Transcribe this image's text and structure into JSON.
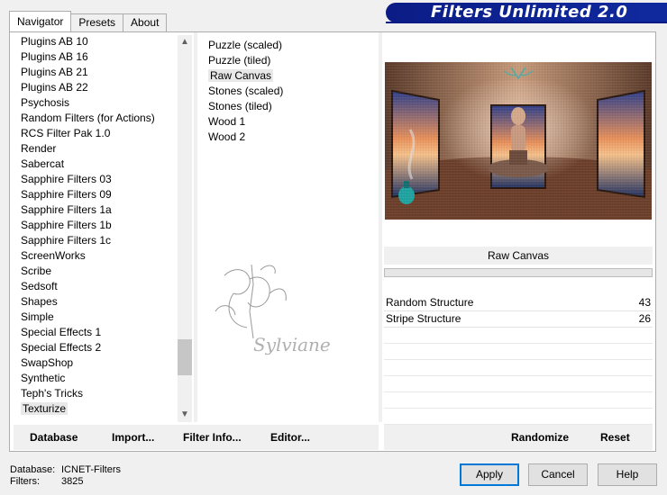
{
  "tabs": [
    {
      "label": "Navigator",
      "active": true
    },
    {
      "label": "Presets",
      "active": false
    },
    {
      "label": "About",
      "active": false
    }
  ],
  "banner": {
    "title": "Filters Unlimited 2.0"
  },
  "categories": [
    "Plugins AB 10",
    "Plugins AB 16",
    "Plugins AB 21",
    "Plugins AB 22",
    "Psychosis",
    "Random Filters (for Actions)",
    "RCS Filter Pak 1.0",
    "Render",
    "Sabercat",
    "Sapphire Filters 03",
    "Sapphire Filters 09",
    "Sapphire Filters 1a",
    "Sapphire Filters 1b",
    "Sapphire Filters 1c",
    "ScreenWorks",
    "Scribe",
    "Sedsoft",
    "Shapes",
    "Simple",
    "Special Effects 1",
    "Special Effects 2",
    "SwapShop",
    "Synthetic",
    "Teph's Tricks",
    "Texturize"
  ],
  "selected_category": "Texturize",
  "filters": [
    "Puzzle (scaled)",
    "Puzzle (tiled)",
    "Raw Canvas",
    "Stones (scaled)",
    "Stones (tiled)",
    "Wood 1",
    "Wood 2"
  ],
  "selected_filter": "Raw Canvas",
  "watermark_text": "Sylviane",
  "preview": {
    "filter_name": "Raw Canvas"
  },
  "params": [
    {
      "label": "Random Structure",
      "value": "43"
    },
    {
      "label": "Stripe Structure",
      "value": "26"
    }
  ],
  "toolbar_left": {
    "database": "Database",
    "import": "Import...",
    "filter_info": "Filter Info...",
    "editor": "Editor..."
  },
  "toolbar_right": {
    "randomize": "Randomize",
    "reset": "Reset"
  },
  "footer": {
    "database_label": "Database:",
    "database_value": "ICNET-Filters",
    "filters_label": "Filters:",
    "filters_value": "3825"
  },
  "buttons": {
    "apply": "Apply",
    "cancel": "Cancel",
    "help": "Help"
  },
  "colors": {
    "banner": "#0b1c86",
    "focus": "#0078d7"
  }
}
